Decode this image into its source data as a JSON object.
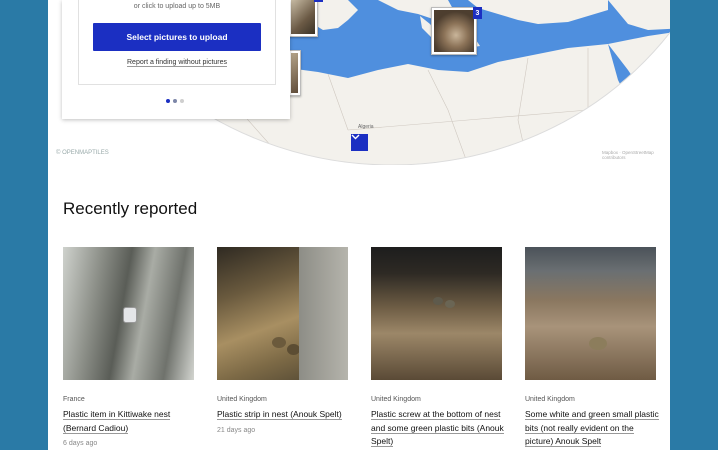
{
  "upload": {
    "hint": "or click to upload up to 5MB",
    "button_label": "Select pictures to upload",
    "no_pictures_link": "Report a finding without pictures"
  },
  "map": {
    "cluster_count": "3",
    "country_label": "Algeria",
    "attribution_left": "© OPENMAPTILES",
    "attribution_right": "Mapbox · OpenStreetMap contributors"
  },
  "section": {
    "title": "Recently reported"
  },
  "cards": [
    {
      "country": "France",
      "title": "Plastic item in Kittiwake nest (Bernard Cadiou)",
      "age": "6 days ago"
    },
    {
      "country": "United Kingdom",
      "title": "Plastic strip in nest (Anouk Spelt)",
      "age": "21 days ago"
    },
    {
      "country": "United Kingdom",
      "title": "Plastic screw at the bottom of nest and some green plastic bits (Anouk Spelt)",
      "age": ""
    },
    {
      "country": "United Kingdom",
      "title": "Some white and green small plastic bits (not really evident on the picture) Anouk Spelt",
      "age": ""
    }
  ],
  "colors": {
    "background": "#2a7aa6",
    "accent": "#1b2fc2",
    "sea": "#4f8fde",
    "land": "#f3f1ec"
  }
}
